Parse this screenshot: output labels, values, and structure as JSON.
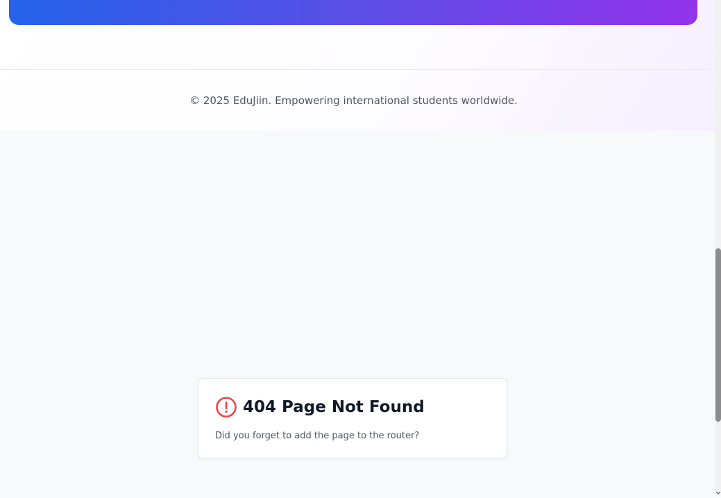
{
  "footer": {
    "copyright": "© 2025 EduJiin. Empowering international students worldwide."
  },
  "not_found": {
    "title": "404 Page Not Found",
    "description": "Did you forget to add the page to the router?",
    "icon": "alert-circle-icon"
  },
  "colors": {
    "banner_start": "#2563eb",
    "banner_end": "#9333ea",
    "alert": "#ef4444",
    "title_text": "#111827",
    "body_text": "#4b5563",
    "page_background": "#f8f9fb"
  }
}
